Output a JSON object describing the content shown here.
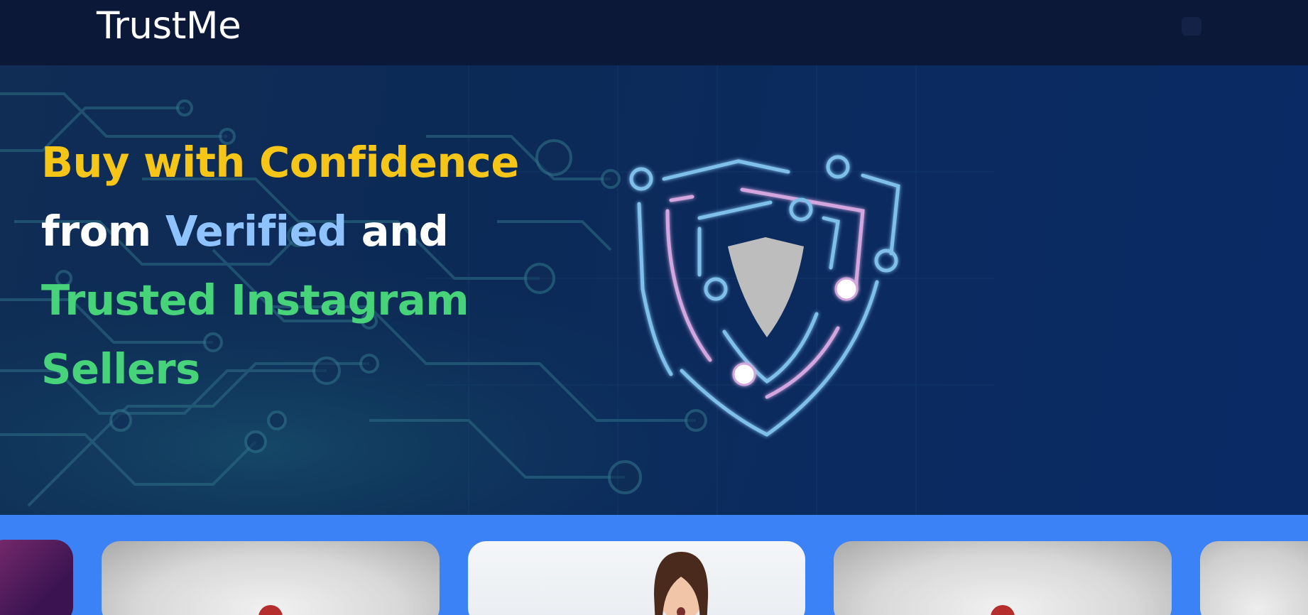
{
  "header": {
    "logo": "TrustMe"
  },
  "hero": {
    "line1": "Buy with Confidence",
    "line2_from": "from",
    "line2_verified": "Verified",
    "line2_and": "and",
    "line3": "Trusted Instagram",
    "line4": "Sellers"
  },
  "colors": {
    "headline_yellow": "#f5c518",
    "headline_blue": "#8ec3ff",
    "headline_green": "#46d37a",
    "strip_blue": "#3b82f6",
    "header_navy": "#0c1838"
  },
  "icons": {
    "hero_illustration": "shield-icon"
  }
}
